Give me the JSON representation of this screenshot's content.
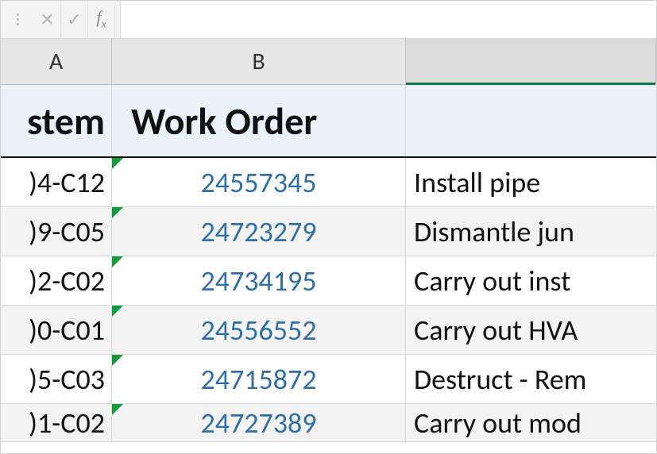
{
  "formula_bar": {
    "cancel_glyph": "✕",
    "enter_glyph": "✓",
    "fx_label": "fx",
    "input_value": ""
  },
  "columns": {
    "A": "A",
    "B": "B",
    "C": ""
  },
  "header_row": {
    "A": "stem",
    "B": "Work Order",
    "C": ""
  },
  "rows": [
    {
      "A": ")4-C12",
      "B": "24557345",
      "C": "Install pipe",
      "has_error": true,
      "alt": false
    },
    {
      "A": ")9-C05",
      "B": "24723279",
      "C": "Dismantle jun",
      "has_error": true,
      "alt": true
    },
    {
      "A": ")2-C02",
      "B": "24734195",
      "C": "Carry out inst",
      "has_error": true,
      "alt": false
    },
    {
      "A": ")0-C01",
      "B": "24556552",
      "C": "Carry out HVA",
      "has_error": true,
      "alt": true
    },
    {
      "A": ")5-C03",
      "B": "24715872",
      "C": "Destruct - Rem",
      "has_error": true,
      "alt": false
    },
    {
      "A": ")1-C02",
      "B": "24727389",
      "C": "Carry out mod",
      "has_error": true,
      "alt": true,
      "last": true
    }
  ],
  "colors": {
    "link_blue": "#2f6fa7",
    "excel_green": "#107c41",
    "error_triangle": "#0f9d3b",
    "header_fill": "#eaf1f8"
  }
}
